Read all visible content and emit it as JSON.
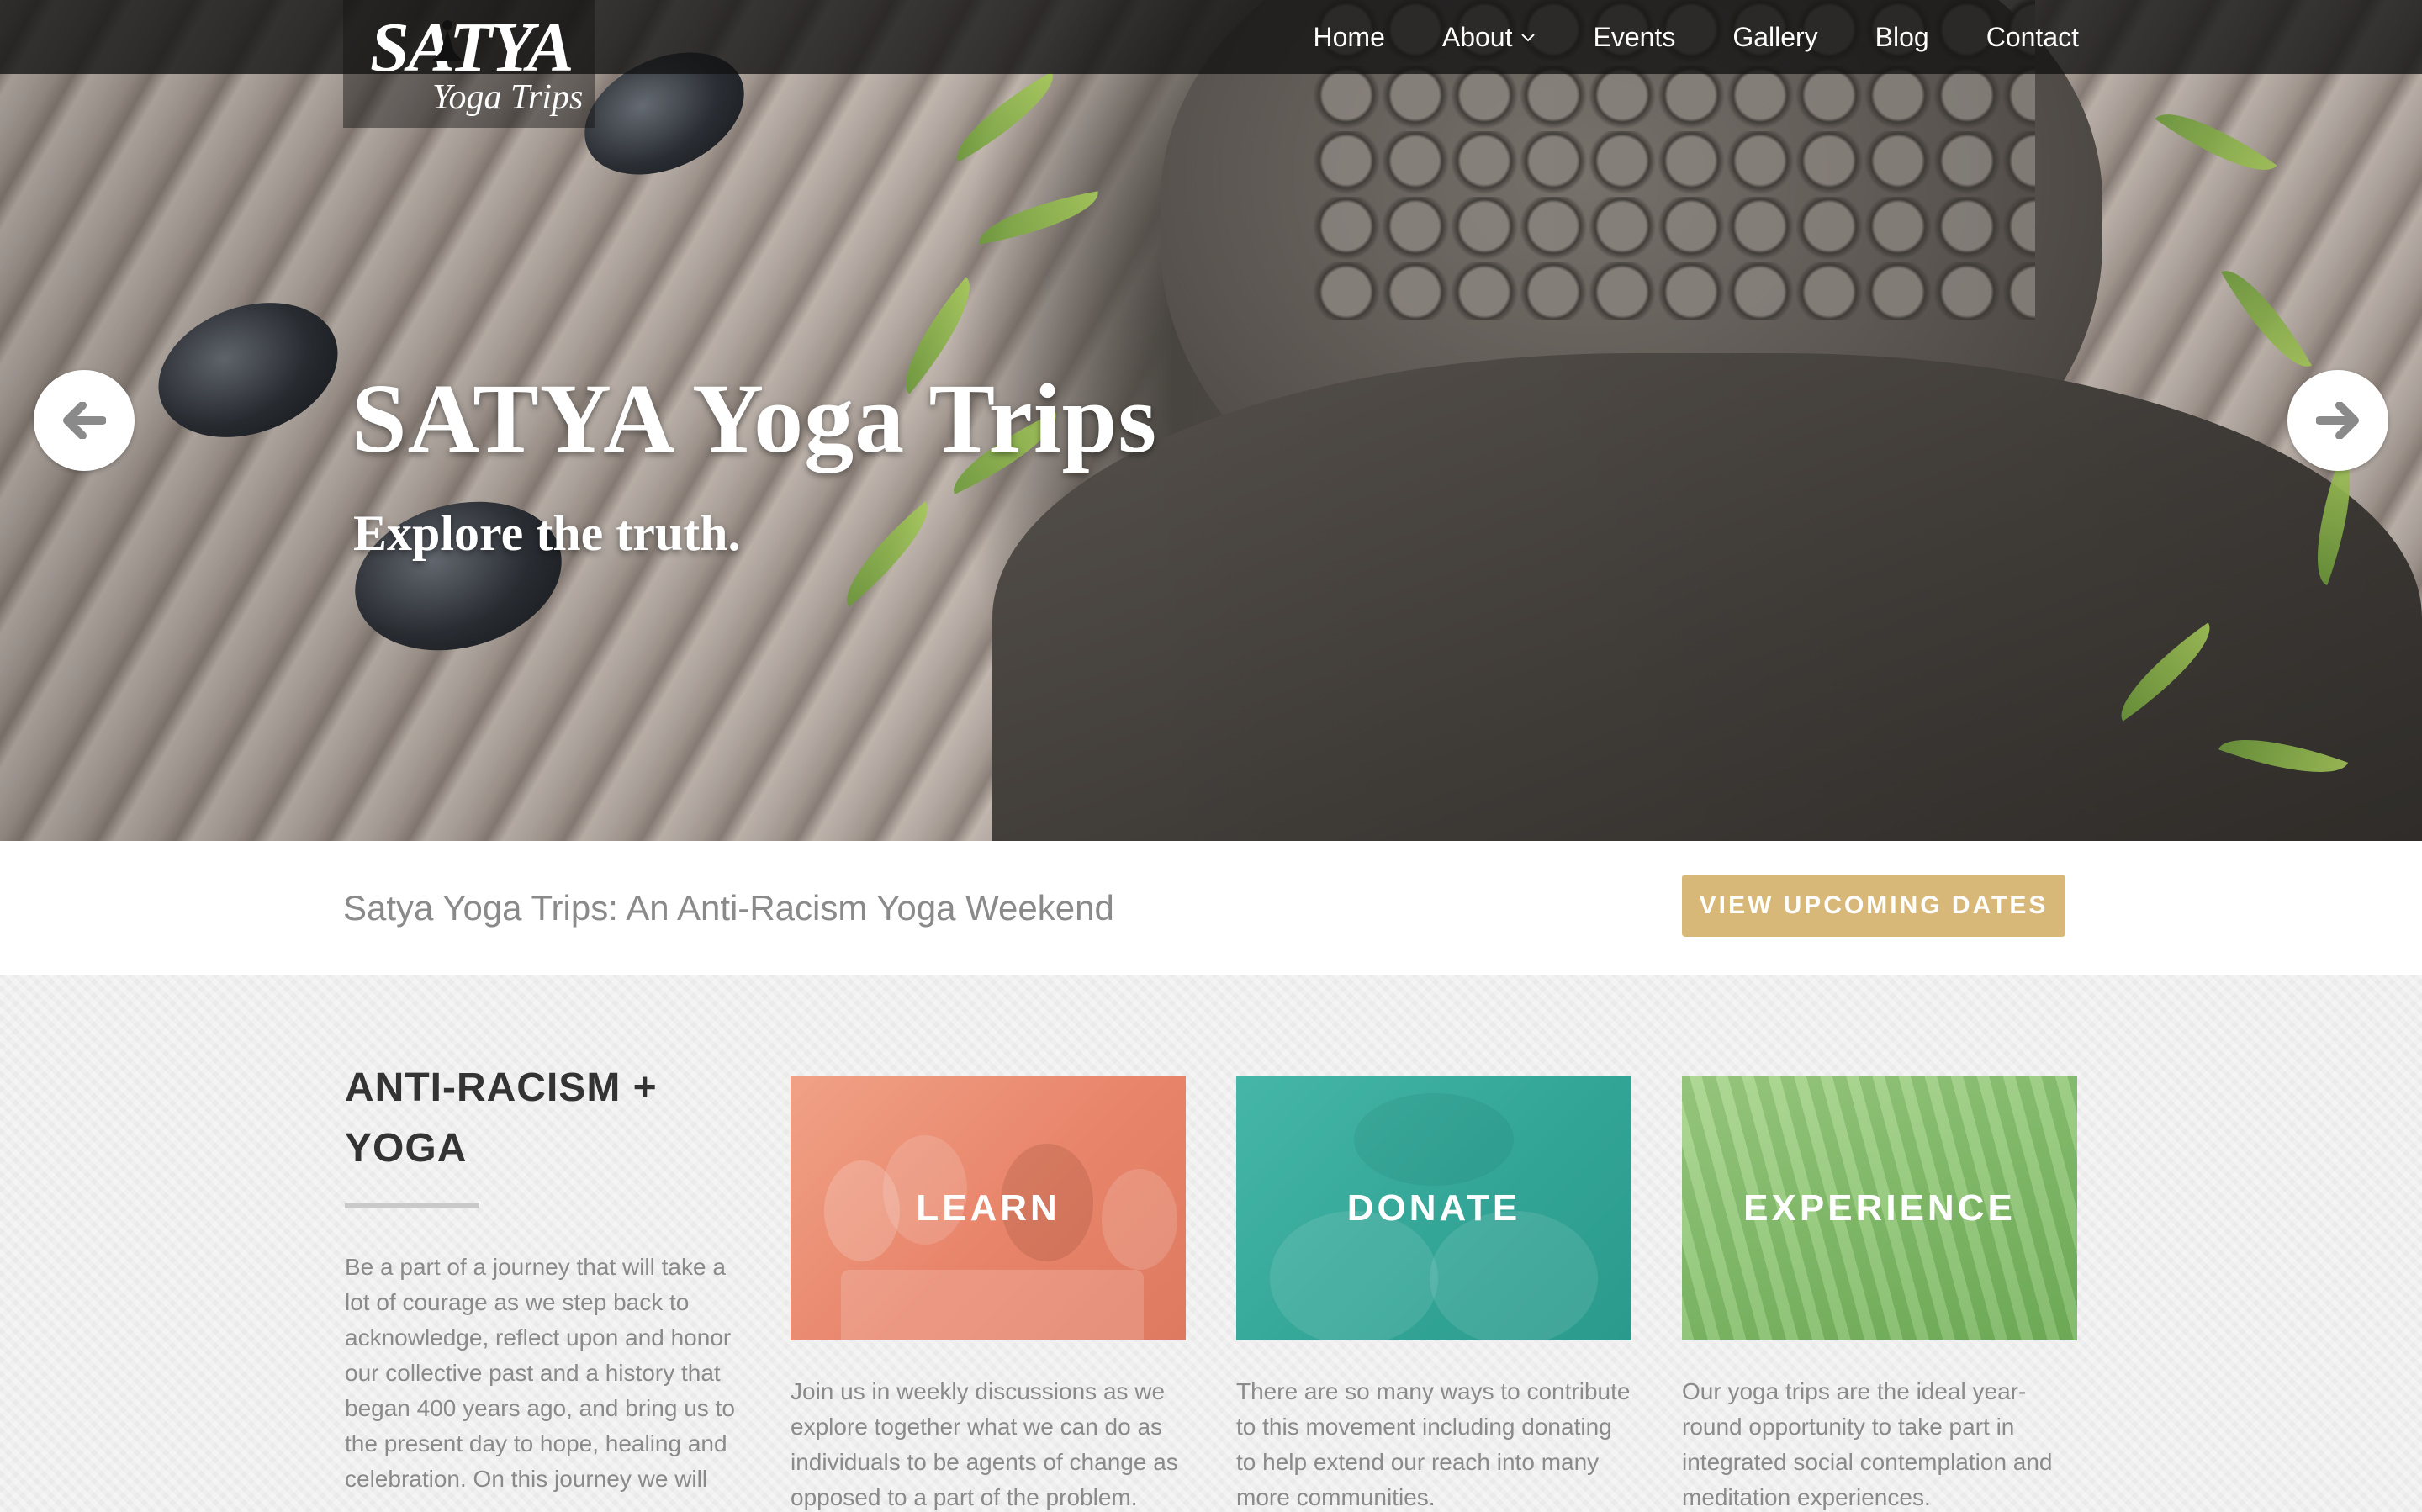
{
  "nav": {
    "logo_main": "SATYA",
    "logo_sub": "Yoga Trips",
    "items": [
      {
        "label": "Home"
      },
      {
        "label": "About",
        "has_dropdown": true
      },
      {
        "label": "Events"
      },
      {
        "label": "Gallery"
      },
      {
        "label": "Blog"
      },
      {
        "label": "Contact"
      }
    ]
  },
  "hero": {
    "title": "SATYA Yoga Trips",
    "subtitle": "Explore the truth.",
    "prev_icon": "arrow-left-icon",
    "next_icon": "arrow-right-icon"
  },
  "callout": {
    "text": "Satya Yoga Trips: An Anti-Racism Yoga Weekend",
    "button_label": "VIEW UPCOMING DATES",
    "button_color": "#d8b878"
  },
  "intro": {
    "title": "ANTI-RACISM + YOGA",
    "text": "Be a part of a journey that will take a lot of courage as we step back to acknowledge, reflect upon and honor our collective past and a history that began 400 years ago, and bring us to the present day to hope, healing and celebration. On this journey we will"
  },
  "cards": [
    {
      "label": "LEARN",
      "text": "Join us in weekly discussions as we explore together what we can do as individuals to be agents of change as opposed to a part of the problem.",
      "color": "#e8846a"
    },
    {
      "label": "DONATE",
      "text": "There are so many ways to contribute to this movement including donating to help extend our reach into many more communities.",
      "color": "#32a496"
    },
    {
      "label": "EXPERIENCE",
      "text": "Our yoga trips are the ideal year-round opportunity to take part in integrated social contemplation and meditation experiences.",
      "color": "#8cc472"
    }
  ]
}
